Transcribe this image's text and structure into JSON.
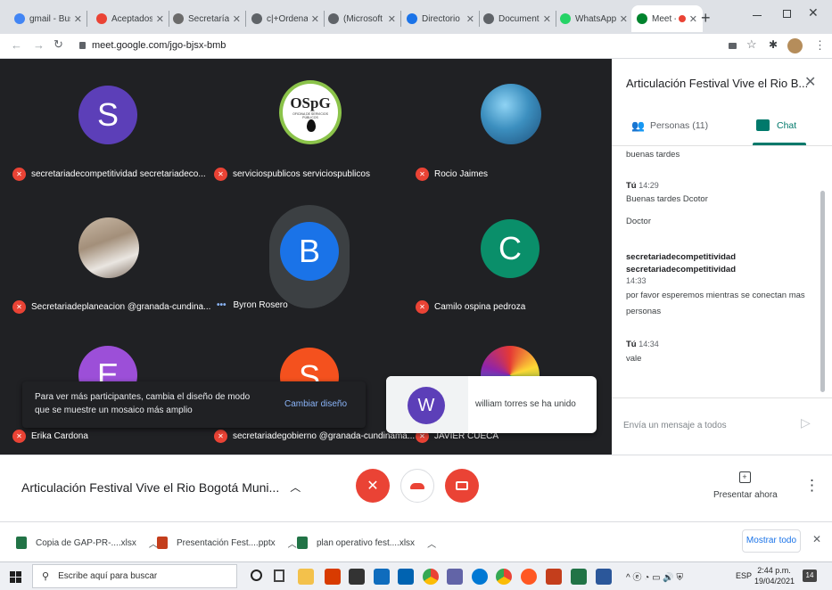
{
  "browser": {
    "tabs": [
      {
        "label": "gmail - Bus",
        "icon": "google-icon",
        "color": "#4285f4"
      },
      {
        "label": "Aceptados",
        "icon": "gmail-icon",
        "color": "#ea4335"
      },
      {
        "label": "Secretaría d",
        "icon": "seal-icon",
        "color": "#6b6b6b"
      },
      {
        "label": "c|+Ordena",
        "icon": "web-icon",
        "color": "#5f6368"
      },
      {
        "label": "(Microsoft",
        "icon": "web-icon",
        "color": "#5f6368"
      },
      {
        "label": "Directorio d",
        "icon": "doc-icon",
        "color": "#1a73e8"
      },
      {
        "label": "Documento",
        "icon": "web-icon",
        "color": "#5f6368"
      },
      {
        "label": "WhatsApp",
        "icon": "whatsapp-icon",
        "color": "#25d366"
      },
      {
        "label": "Meet - ",
        "icon": "meet-icon",
        "color": "#00832d",
        "active": true
      }
    ],
    "new_tab": "+",
    "url": "meet.google.com/jgo-bjsx-bmb"
  },
  "meeting": {
    "participants": [
      {
        "name": "secretariadecompetitividad secretariadeco...",
        "initial": "S",
        "color": "#5c3fb8",
        "muted": true
      },
      {
        "name": "serviciospublicos serviciospublicos",
        "logo_text": "OSpG",
        "logo_subtext": "OFICINA DE SERVICIOS PÚBLICOS",
        "muted": true
      },
      {
        "name": "Rocio Jaimes",
        "photo": "ocean",
        "muted": true
      },
      {
        "name": "Secretariadeplaneacion @granada-cundina...",
        "photo": "room",
        "muted": true
      },
      {
        "name": "Byron Rosero",
        "initial": "B",
        "color": "#1a73e8",
        "muted": false,
        "speaking": "•••"
      },
      {
        "name": "Camilo ospina pedroza",
        "initial": "C",
        "color": "#0a8f6a",
        "muted": true
      },
      {
        "name": "Erika Cardona",
        "initial": "E",
        "color": "#9c4fd8",
        "muted": true
      },
      {
        "name": "secretariadegobierno @granada-cundinama...",
        "initial": "S",
        "color": "#f4511e",
        "muted": true
      },
      {
        "name": "JAVIER CUECA",
        "photo": "colorful",
        "muted": true
      }
    ],
    "layout_toast": {
      "text": "Para ver más participantes, cambia el diseño de modo que se muestre un mosaico más amplio",
      "action": "Cambiar diseño"
    },
    "join_toast": {
      "initial": "W",
      "color": "#5c3fb8",
      "text": "william torres se ha unido"
    }
  },
  "panel": {
    "title": "Articulación Festival Vive el Rio B...",
    "tabs": {
      "people": "Personas (11)",
      "chat": "Chat"
    },
    "messages": [
      {
        "sender": "",
        "time": "",
        "lines": [
          "buenas tardes"
        ]
      },
      {
        "sender": "Tú",
        "time": "14:29",
        "lines": [
          "Buenas tardes Dcotor",
          "Doctor"
        ]
      },
      {
        "sender": "secretariadecompetitividad secretariadecompetitividad",
        "time": "14:33",
        "lines": [
          "por favor esperemos mientras se conectan mas personas"
        ]
      },
      {
        "sender": "Tú",
        "time": "14:34",
        "lines": [
          "vale"
        ]
      }
    ],
    "input_placeholder": "Envía un mensaje a todos"
  },
  "bottombar": {
    "meeting_title": "Articulación Festival Vive el Rio Bogotá Muni...",
    "present_label": "Presentar ahora",
    "colors": {
      "danger": "#ea4335"
    }
  },
  "downloads": {
    "items": [
      "Copia de GAP-PR-....xlsx",
      "Presentación Fest....pptx",
      "plan operativo fest....xlsx"
    ],
    "show_all": "Mostrar todo"
  },
  "taskbar": {
    "search_placeholder": "Escribe aquí para buscar",
    "lang": "ESP",
    "time": "2:44 p.m.",
    "date": "19/04/2021",
    "notifications": "14"
  }
}
